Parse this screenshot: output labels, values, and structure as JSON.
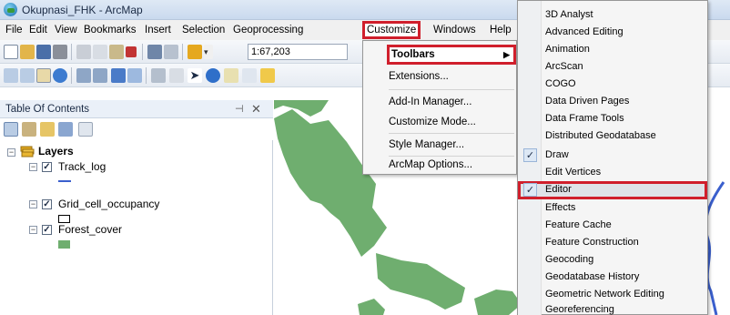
{
  "window": {
    "title": "Okupnasi_FHK - ArcMap"
  },
  "menubar": {
    "items": [
      "File",
      "Edit",
      "View",
      "Bookmarks",
      "Insert",
      "Selection",
      "Geoprocessing",
      "Customize",
      "Windows",
      "Help"
    ]
  },
  "toolbar": {
    "scale": "1:67,203"
  },
  "toc": {
    "title": "Table Of Contents",
    "root": "Layers",
    "layers": [
      {
        "name": "Track_log",
        "checked": true,
        "symbol": "line",
        "color": "#3a5fcd"
      },
      {
        "name": "Grid_cell_occupancy",
        "checked": true,
        "symbol": "hollow-rect",
        "color": "#000000"
      },
      {
        "name": "Forest_cover",
        "checked": true,
        "symbol": "filled-rect",
        "color": "#6fae6f"
      }
    ]
  },
  "customize_menu": {
    "items": [
      "Toolbars",
      "Extensions...",
      "Add-In Manager...",
      "Customize Mode...",
      "Style Manager...",
      "ArcMap Options..."
    ],
    "highlighted": "Toolbars"
  },
  "toolbars_submenu": {
    "items": [
      {
        "label": "3D Analyst",
        "checked": false
      },
      {
        "label": "Advanced Editing",
        "checked": false
      },
      {
        "label": "Animation",
        "checked": false
      },
      {
        "label": "ArcScan",
        "checked": false
      },
      {
        "label": "COGO",
        "checked": false
      },
      {
        "label": "Data Driven Pages",
        "checked": false
      },
      {
        "label": "Data Frame Tools",
        "checked": false
      },
      {
        "label": "Distributed Geodatabase",
        "checked": false
      },
      {
        "label": "Draw",
        "checked": true
      },
      {
        "label": "Edit Vertices",
        "checked": false
      },
      {
        "label": "Editor",
        "checked": true,
        "highlighted": true
      },
      {
        "label": "Effects",
        "checked": false
      },
      {
        "label": "Feature Cache",
        "checked": false
      },
      {
        "label": "Feature Construction",
        "checked": false
      },
      {
        "label": "Geocoding",
        "checked": false
      },
      {
        "label": "Geodatabase History",
        "checked": false
      },
      {
        "label": "Geometric Network Editing",
        "checked": false
      },
      {
        "label": "Georeferencing",
        "checked": false
      }
    ]
  },
  "colors": {
    "highlight_outline": "#d01f2c",
    "forest": "#6fae6f",
    "water": "#3a5fcd"
  }
}
